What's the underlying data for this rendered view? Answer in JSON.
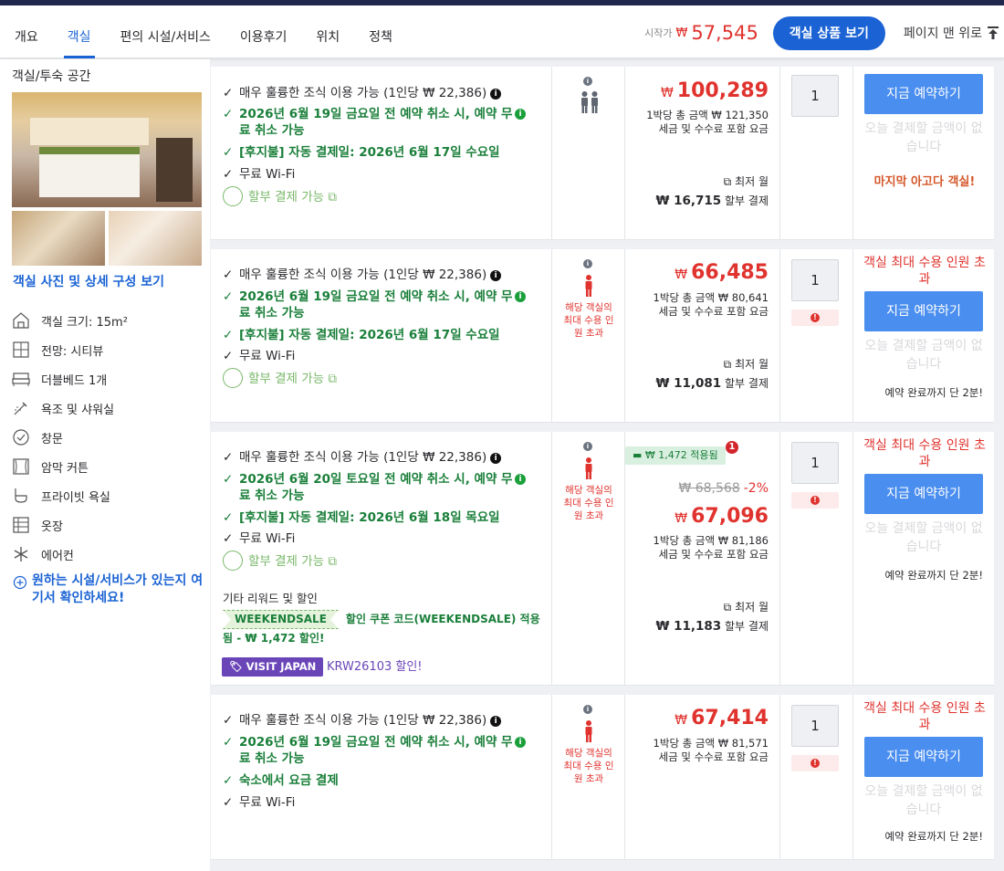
{
  "nav": {
    "tabs": [
      "개요",
      "객실",
      "편의 시설/서비스",
      "이용후기",
      "위치",
      "정책"
    ],
    "active_tab": 1,
    "start_label": "시작가",
    "start_currency": "₩",
    "start_price": "57,545",
    "view_rooms_button": "객실 상품 보기",
    "top_link": "페이지 맨 위로"
  },
  "sidebar": {
    "title": "객실/투숙 공간",
    "photo_link": "객실 사진 및 상세 구성 보기",
    "amenities": [
      {
        "icon": "room-size-icon",
        "label": "객실 크기: 15m²"
      },
      {
        "icon": "city-view-icon",
        "label": "전망: 시티뷰"
      },
      {
        "icon": "double-bed-icon",
        "label": "더블베드 1개"
      },
      {
        "icon": "shower-icon",
        "label": "욕조 및 샤워실"
      },
      {
        "icon": "window-icon",
        "label": "창문"
      },
      {
        "icon": "blackout-curtain-icon",
        "label": "암막 커튼"
      },
      {
        "icon": "private-bath-icon",
        "label": "프라이빗 욕실"
      },
      {
        "icon": "wardrobe-icon",
        "label": "옷장"
      },
      {
        "icon": "snowflake-icon",
        "label": "에어컨"
      }
    ],
    "facility_link": "원하는 시설/서비스가 있는지 여기서 확인하세요!"
  },
  "common": {
    "breakfast": "매우 훌륭한 조식 이용 가능 (1인당 ₩ 22,386)",
    "wifi": "무료 Wi-Fi",
    "installment": "할부 결제 가능",
    "book_button": "지금 예약하기",
    "no_pay_today": "오늘 결제할 금액이 없습니다",
    "lowest_monthly": "최저 월",
    "installment_suffix": "할부 결제",
    "occupancy_exceeded": "객실 최대 수용 인원 초과",
    "occupancy_small": "해당 객실의 최대 수용 인원 초과",
    "booking_soon": "예약 완료까지 단 2분!",
    "price_currency": "₩",
    "tax_note": "세금 및 수수료 포함 요금",
    "qty": "1"
  },
  "rows": [
    {
      "cancel": "2026년 6월 19일 금요일 전 예약 취소 시, 예약 무료 취소 가능",
      "third": "[후지불] 자동 결제일: 2026년 6월 17일 수요일",
      "price": "100,289",
      "total": "1박당 총 금액 ₩ 121,350",
      "monthly": "₩ 16,715",
      "last_room": "마지막 아고다 객실!"
    },
    {
      "cancel": "2026년 6월 19일 금요일 전 예약 취소 시, 예약 무료 취소 가능",
      "third": "[후지불] 자동 결제일: 2026년 6월 17일 수요일",
      "price": "66,485",
      "total": "1박당 총 금액 ₩ 80,641",
      "monthly": "₩ 11,081"
    },
    {
      "cancel": "2026년 6월 20일 토요일 전 예약 취소 시, 예약 무료 취소 가능",
      "third": "[후지불] 자동 결제일: 2026년 6월 18일 목요일",
      "saved_badge": "₩ 1,472 적용됨",
      "saved_count": "1",
      "original_price": "₩ 68,568",
      "discount_pct": "-2%",
      "price": "67,096",
      "total": "1박당 총 금액 ₩ 81,186",
      "monthly": "₩ 11,183",
      "promo_title": "기타 리워드 및 할인",
      "coupon_code": "WEEKENDSALE",
      "coupon_text": "할인 쿠폰 코드(WEEKENDSALE) 적용됨 - ₩ 1,472 할인!",
      "vj_badge": "VISIT JAPAN",
      "vj_text": "KRW26103 할인!"
    },
    {
      "cancel": "2026년 6월 19일 금요일 전 예약 취소 시, 예약 무료 취소 가능",
      "third": "숙소에서 요금 결제",
      "price": "67,414",
      "total": "1박당 총 금액 ₩ 81,571"
    }
  ],
  "colors": {
    "brand_blue": "#1b63d4",
    "price_red": "#e0332e",
    "benefit_green": "#1a7f3a",
    "book_button": "#4a8ef0",
    "top_band": "#20274d"
  }
}
